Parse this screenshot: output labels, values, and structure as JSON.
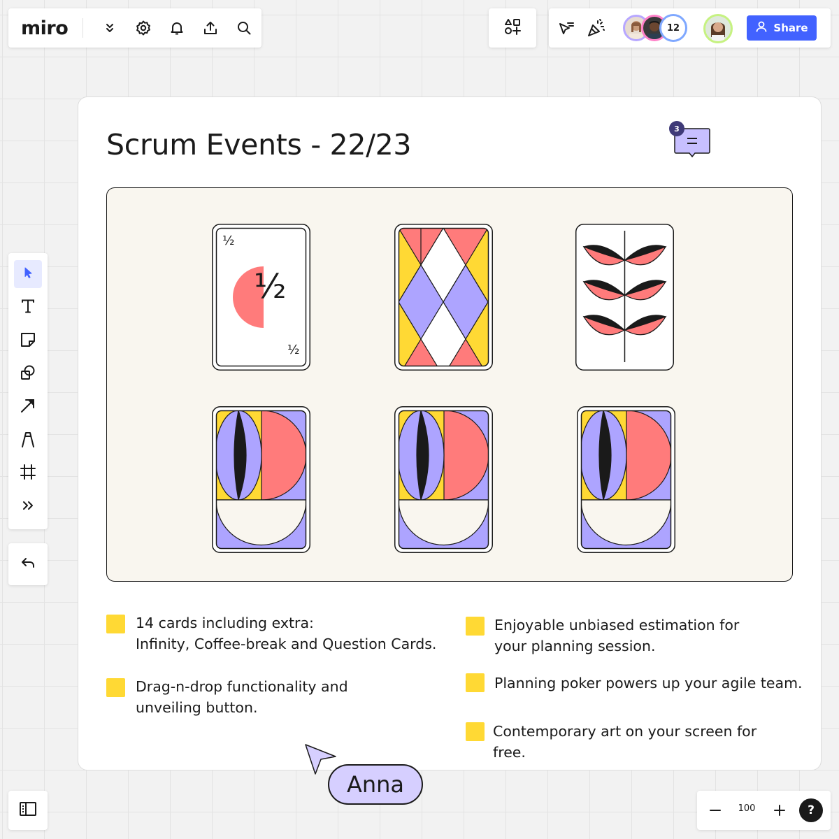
{
  "app": {
    "logo": "miro"
  },
  "board": {
    "title": "Scrum Events - 22/23"
  },
  "comments": {
    "count": "3"
  },
  "collaborators": {
    "count": "12"
  },
  "share": {
    "label": "Share"
  },
  "cards": {
    "fraction_card": {
      "label": "½",
      "corner": "½"
    }
  },
  "features": {
    "left": [
      {
        "line1": "14 cards including extra:",
        "line2": "Infinity, Coffee-break and Question Cards."
      },
      {
        "line1": "Drag-n-drop functionality and",
        "line2": "unveiling button."
      }
    ],
    "right": [
      {
        "line1": "Enjoyable unbiased estimation for",
        "line2": "your planning session."
      },
      {
        "line1": "Planning poker powers up your agile team.",
        "line2": ""
      },
      {
        "line1": "Contemporary art on your screen for",
        "line2": "free."
      }
    ]
  },
  "cursor": {
    "name": "Anna"
  },
  "zoom": {
    "level": "100",
    "help": "?"
  },
  "colors": {
    "accent": "#4262ff",
    "sticky": "#ffd934",
    "card_red": "#ff7b7b",
    "card_purple": "#ada4ff",
    "card_yellow": "#ffd934",
    "canvas_bg": "#f9f6ef"
  },
  "icons": {
    "toolbar": [
      "chevron-double-down-icon",
      "settings-icon",
      "bell-icon",
      "upload-icon",
      "search-icon"
    ],
    "tools": [
      "select-icon",
      "text-icon",
      "sticky-note-icon",
      "shapes-icon",
      "arrow-icon",
      "pen-icon",
      "frame-icon",
      "more-tools-icon"
    ]
  }
}
